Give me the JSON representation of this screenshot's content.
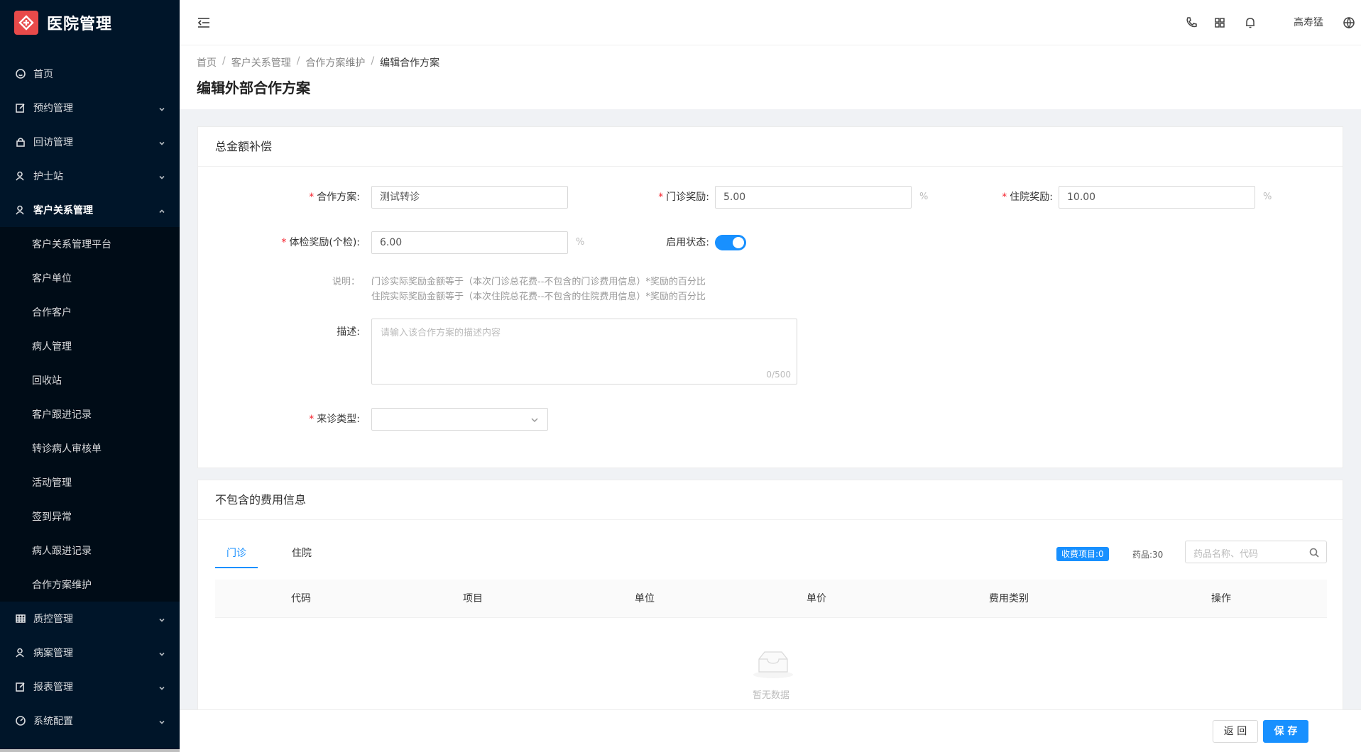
{
  "app": {
    "title": "医院管理",
    "brand_color": "#e84a4a",
    "accent_color": "#1890ff"
  },
  "sidebar": {
    "items": [
      {
        "label": "首页",
        "icon": "smile-icon"
      },
      {
        "label": "预约管理",
        "icon": "edit-icon"
      },
      {
        "label": "回访管理",
        "icon": "lock-icon"
      },
      {
        "label": "护士站",
        "icon": "user-icon"
      },
      {
        "label": "客户关系管理",
        "icon": "team-icon"
      }
    ],
    "subitems": [
      "客户关系管理平台",
      "客户单位",
      "合作客户",
      "病人管理",
      "回收站",
      "客户跟进记录",
      "转诊病人审核单",
      "活动管理",
      "签到异常",
      "病人跟进记录",
      "合作方案维护"
    ],
    "items_after": [
      {
        "label": "质控管理",
        "icon": "table-icon"
      },
      {
        "label": "病案管理",
        "icon": "team-icon"
      },
      {
        "label": "报表管理",
        "icon": "edit-icon"
      },
      {
        "label": "系统配置",
        "icon": "dashboard-icon"
      }
    ]
  },
  "header": {
    "user_name": "高寿猛"
  },
  "breadcrumb": [
    "首页",
    "客户关系管理",
    "合作方案维护",
    "编辑合作方案"
  ],
  "page_title": "编辑外部合作方案",
  "section1": {
    "title": "总金额补偿",
    "plan_label": "合作方案:",
    "plan_value": "测试转诊",
    "outpatient_label": "门诊奖励:",
    "outpatient_value": "5.00",
    "inpatient_label": "住院奖励:",
    "inpatient_value": "10.00",
    "exam_label": "体检奖励(个检):",
    "exam_value": "6.00",
    "unit": "%",
    "status_label": "启用状态:",
    "status_on": true,
    "note_label": "说明：",
    "note_line1": "门诊实际奖励金额等于（本次门诊总花费--不包含的门诊费用信息）*奖励的百分比",
    "note_line2": "住院实际奖励金额等于（本次住院总花费--不包含的住院费用信息）*奖励的百分比",
    "desc_label": "描述:",
    "desc_placeholder": "请输入该合作方案的描述内容",
    "desc_count": "0/500",
    "visit_type_label": "来诊类型:"
  },
  "section2": {
    "title": "不包含的费用信息",
    "tabs": [
      "门诊",
      "住院"
    ],
    "badge": "收费项目:0",
    "drug_count": "药品:30",
    "search_placeholder": "药品名称、代码",
    "columns": [
      "代码",
      "项目",
      "单位",
      "单价",
      "费用类别",
      "操作"
    ],
    "empty_text": "暂无数据"
  },
  "footer": {
    "back_label": "返 回",
    "save_label": "保 存"
  }
}
